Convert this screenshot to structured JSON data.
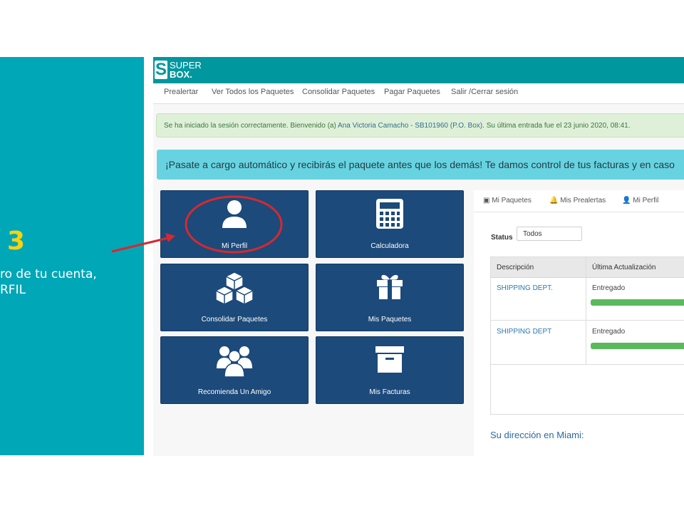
{
  "slide": {
    "step_number": "3",
    "line1": "ro de tu cuenta,",
    "line2": "RFIL",
    "accent_color": "#00a7b7",
    "number_color": "#f5d312",
    "arrow_color": "#d7282f"
  },
  "app": {
    "logo_line1": "SUPER",
    "logo_line2": "BOX.",
    "logo_letter": "S"
  },
  "nav": {
    "items": [
      "Prealertar",
      "Ver Todos los Paquetes",
      "Consolidar Paquetes",
      "Pagar Paquetes",
      "Salir /Cerrar sesión"
    ]
  },
  "alert": {
    "prefix": "Se ha iniciado la sesión correctamente. Bienvenido (a)",
    "user": "Ana Victoria Camacho - SB101960 (P.O. Box).",
    "suffix": "Su última entrada fue el 23 junio 2020, 08:41."
  },
  "promo": {
    "text": "¡Pasate a cargo automático y recibirás el paquete antes que los demás! Te damos control de tus facturas y en caso"
  },
  "tiles": {
    "mi_perfil": {
      "label": "Mi Perfil",
      "icon": "user-icon"
    },
    "calculadora": {
      "label": "Calculadora",
      "icon": "calculator-icon"
    },
    "consolidar": {
      "label": "Consolidar Paquetes",
      "icon": "cubes-icon"
    },
    "mis_paquetes": {
      "label": "Mis Paquetes",
      "icon": "gift-icon"
    },
    "recomienda": {
      "label": "Recomienda Un Amigo",
      "icon": "users-icon"
    },
    "mis_facturas": {
      "label": "Mis Facturas",
      "icon": "archive-icon"
    }
  },
  "panel": {
    "tabs": [
      {
        "label": "Mi Paquetes",
        "icon": "package-icon"
      },
      {
        "label": "Mis Prealertas",
        "icon": "bell-icon"
      },
      {
        "label": "Mi Perfil",
        "icon": "user-icon"
      }
    ],
    "status_label": "Status",
    "status_value": "Todos",
    "columns": [
      "Descripción",
      "Última Actualización"
    ],
    "rows": [
      {
        "descripcion": "SHIPPING DEPT.",
        "estado": "Entregado",
        "progress": 1.0
      },
      {
        "descripcion": "SHIPPING DEPT",
        "estado": "Entregado",
        "progress": 1.0
      }
    ],
    "miami_heading": "Su dirección en Miami:"
  }
}
